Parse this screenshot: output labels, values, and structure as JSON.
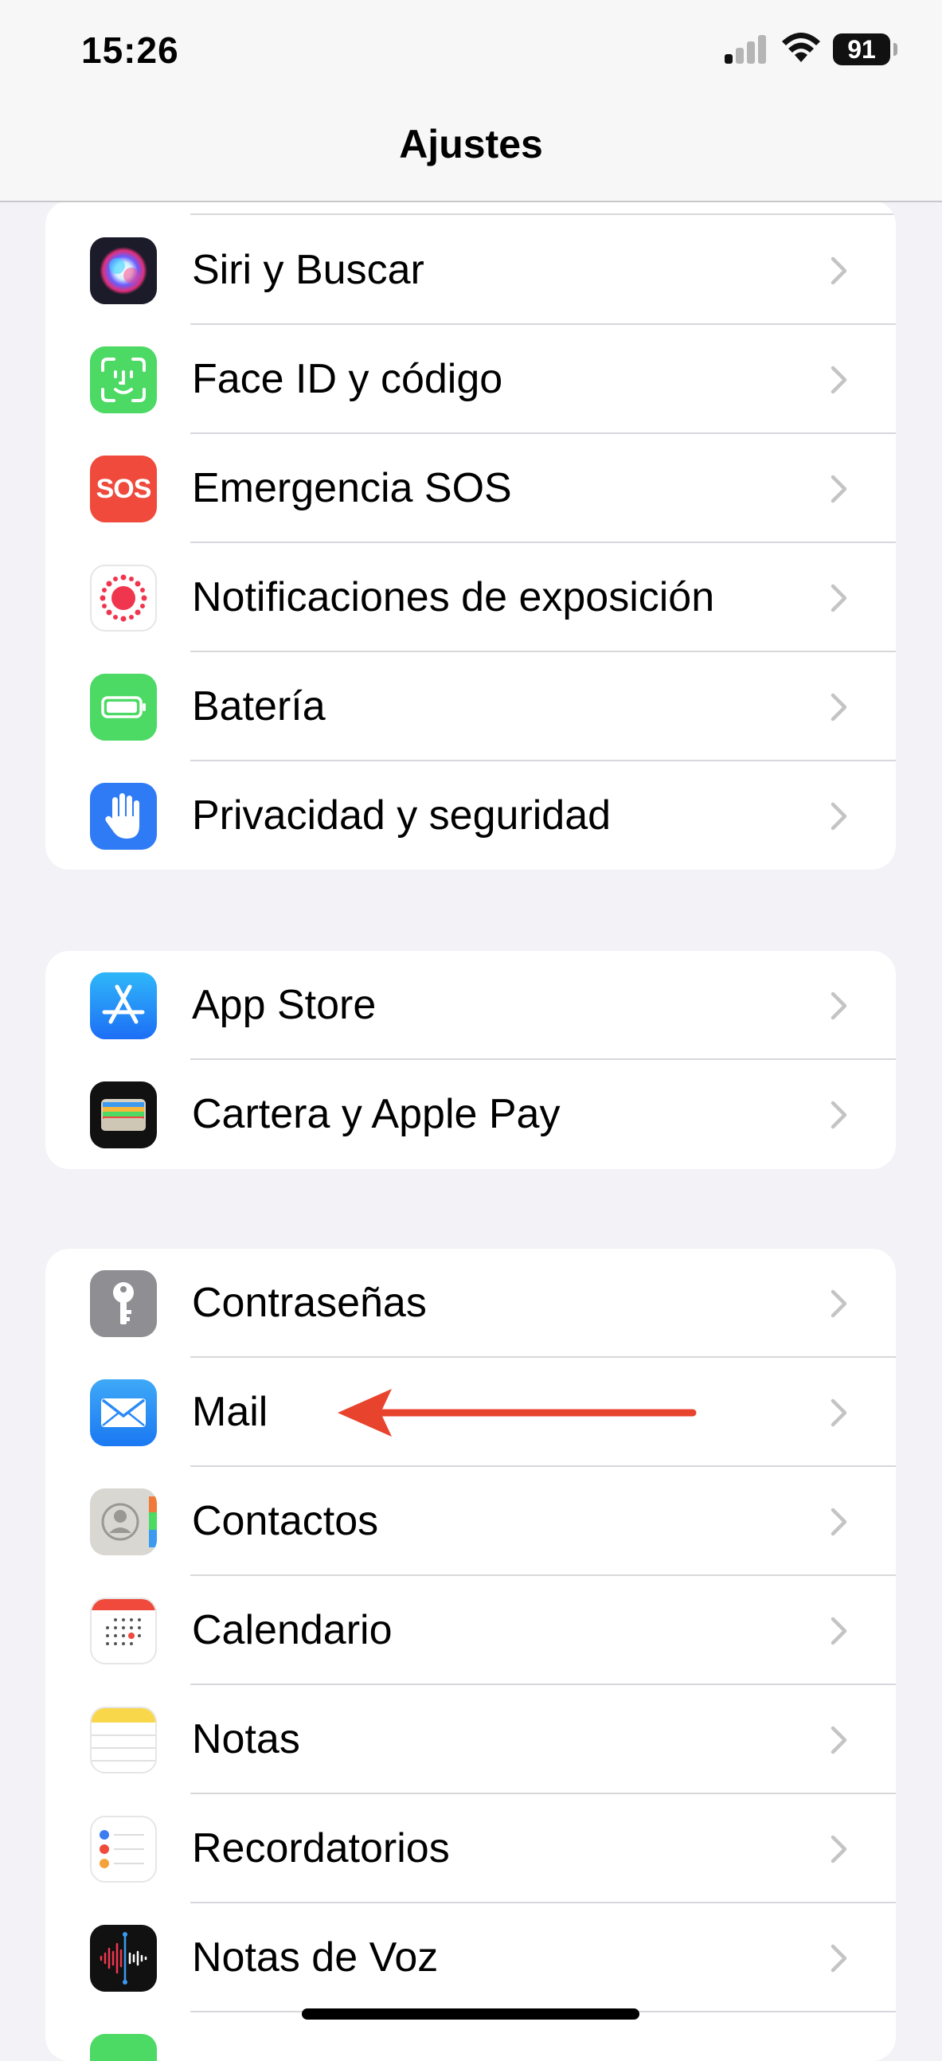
{
  "status_bar": {
    "time": "15:26",
    "battery": "91"
  },
  "nav": {
    "title": "Ajustes"
  },
  "groups": [
    {
      "items": [
        {
          "label": "Siri y Buscar",
          "icon": "siri-icon"
        },
        {
          "label": "Face ID y código",
          "icon": "face-id-icon"
        },
        {
          "label": "Emergencia SOS",
          "icon": "sos-icon",
          "icon_text": "SOS"
        },
        {
          "label": "Notificaciones de exposición",
          "icon": "exposure-icon"
        },
        {
          "label": "Batería",
          "icon": "battery-icon"
        },
        {
          "label": "Privacidad y seguridad",
          "icon": "hand-icon"
        }
      ]
    },
    {
      "items": [
        {
          "label": "App Store",
          "icon": "app-store-icon"
        },
        {
          "label": "Cartera y Apple Pay",
          "icon": "wallet-icon"
        }
      ]
    },
    {
      "items": [
        {
          "label": "Contraseñas",
          "icon": "key-icon"
        },
        {
          "label": "Mail",
          "icon": "mail-icon"
        },
        {
          "label": "Contactos",
          "icon": "contacts-icon"
        },
        {
          "label": "Calendario",
          "icon": "calendar-icon"
        },
        {
          "label": "Notas",
          "icon": "notes-icon"
        },
        {
          "label": "Recordatorios",
          "icon": "reminders-icon"
        },
        {
          "label": "Notas de Voz",
          "icon": "voice-memos-icon"
        }
      ]
    }
  ],
  "colors": {
    "annotation_arrow": "#e8432d",
    "background": "#f2f2f7",
    "chevron": "#c4c4c7"
  }
}
